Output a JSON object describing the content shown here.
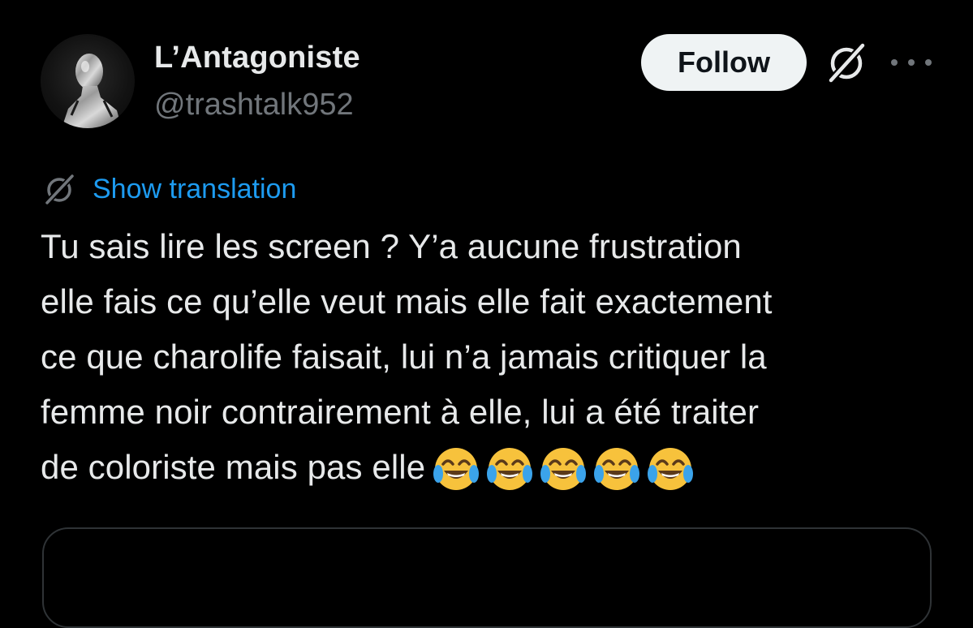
{
  "author": {
    "display_name": "L’Antagoniste",
    "handle": "@trashtalk952",
    "avatar_icon": "avatar-silver-figure"
  },
  "actions": {
    "follow_label": "Follow",
    "grok_icon": "grok-icon",
    "more_icon": "more-dots-icon"
  },
  "translation": {
    "icon": "grok-icon",
    "label": "Show translation"
  },
  "tweet": {
    "lines": [
      "Tu sais lire les screen ? Y’a aucune frustration",
      "elle fais ce qu’elle veut mais elle fait exactement",
      "ce que charolife faisait, lui n’a jamais critiquer la",
      "femme noir contrairement à elle, lui a été traiter",
      "de coloriste mais pas elle"
    ],
    "emojis": [
      "😂",
      "😂",
      "😂",
      "😂",
      "😂"
    ]
  },
  "colors": {
    "background": "#000000",
    "text_primary": "#e7e9ea",
    "text_secondary": "#71767b",
    "link": "#1d9bf0",
    "button_bg": "#eff3f4",
    "border": "#2f3336"
  }
}
